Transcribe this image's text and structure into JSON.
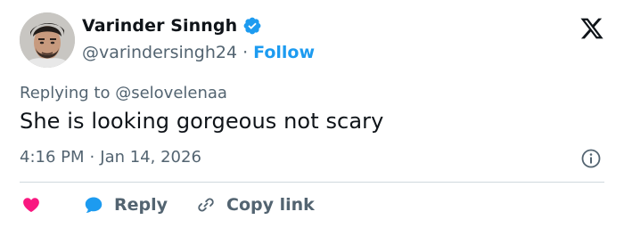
{
  "user": {
    "display_name": "Varinder Sinngh",
    "handle": "@varindersingh24",
    "separator": "·",
    "follow_label": "Follow"
  },
  "tweet": {
    "replying_to": "Replying to @selovelenaa",
    "text": "She is looking gorgeous not scary",
    "time": "4:16 PM",
    "time_separator": "·",
    "date": "Jan 14, 2026"
  },
  "actions": {
    "reply_label": "Reply",
    "copy_link_label": "Copy link"
  },
  "colors": {
    "accent": "#1d9bf0",
    "heart": "#f91880",
    "muted_text": "#536471",
    "primary_text": "#0f1419",
    "divider": "#cfd9de"
  },
  "icons": {
    "verified": "verified-badge-icon",
    "logo": "x-logo-icon",
    "info": "info-icon",
    "like": "heart-icon",
    "reply": "speech-bubble-icon",
    "copy_link": "link-icon"
  }
}
